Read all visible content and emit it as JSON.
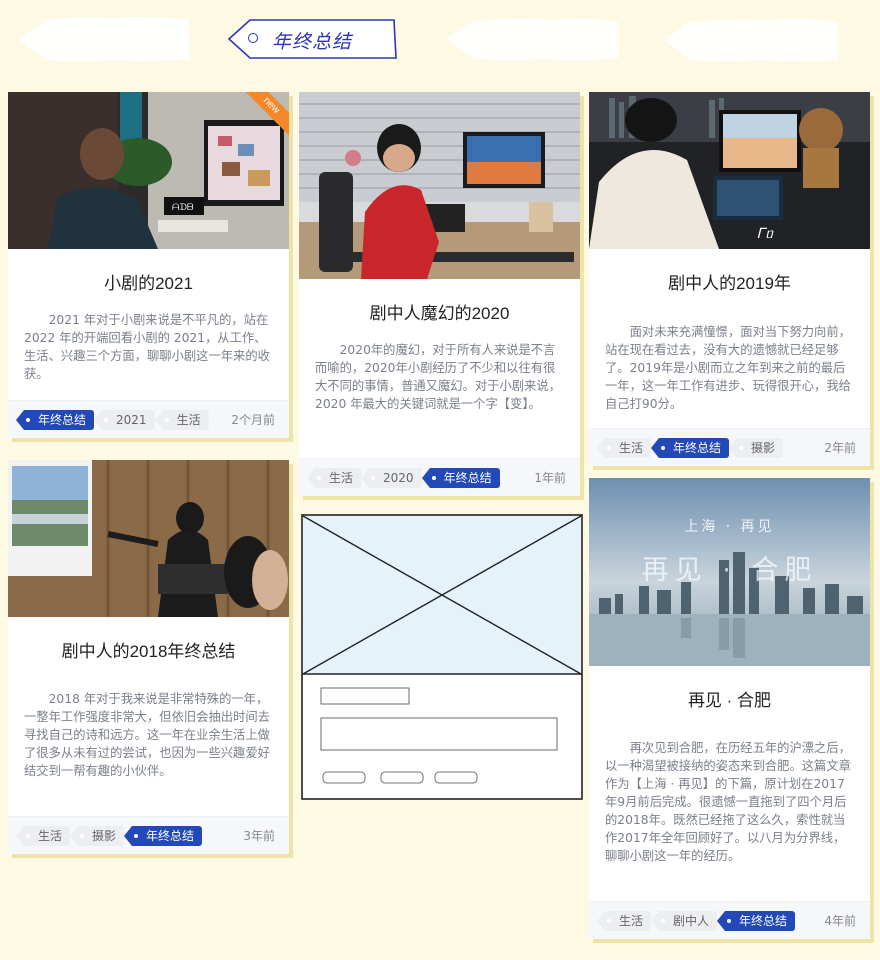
{
  "tabs": {
    "active_label": "年终总结"
  },
  "colors": {
    "accent": "#2249b7",
    "background": "#fdf9e3",
    "badge": "#f2882a"
  },
  "cards": [
    {
      "title": "小剧的2021",
      "excerpt": "2021 年对于小剧来说是不平凡的，站在 2022 年的开端回看小剧的 2021，从工作、生活、兴趣三个方面，聊聊小剧这一年来的收获。",
      "badge": "new",
      "tags": [
        "年终总结",
        "2021",
        "生活"
      ],
      "time": "2个月前"
    },
    {
      "title": "剧中人魔幻的2020",
      "excerpt": "2020年的魔幻，对于所有人来说是不言而喻的，2020年小剧经历了不少和以往有很大不同的事情，普通又魔幻。对于小剧来说，2020 年最大的关键词就是一个字【变】。",
      "tags": [
        "生活",
        "2020",
        "年终总结"
      ],
      "time": "1年前"
    },
    {
      "title": "剧中人的2019年",
      "excerpt": "面对未来充满憧憬，面对当下努力向前，站在现在看过去，没有大的遗憾就已经足够了。2019年是小剧而立之年到来之前的最后一年，这一年工作有进步、玩得很开心，我给自己打90分。",
      "tags": [
        "生活",
        "年终总结",
        "摄影"
      ],
      "time": "2年前"
    },
    {
      "title": "剧中人的2018年终总结",
      "excerpt": "2018 年对于我来说是非常特殊的一年，一整年工作强度非常大，但依旧会抽出时间去寻找自己的诗和远方。这一年在业余生活上做了很多从未有过的尝试，也因为一些兴趣爱好结交到一帮有趣的小伙伴。",
      "tags": [
        "生活",
        "摄影",
        "年终总结"
      ],
      "time": "3年前"
    },
    {
      "title": "再见 · 合肥",
      "image_caption_top": "上海 · 再见",
      "image_caption_main": "再见 · 合肥",
      "excerpt": "再次见到合肥，在历经五年的沪漂之后，以一种渴望被接纳的姿态来到合肥。这篇文章作为【上海 · 再见】的下篇，原计划在2017年9月前后完成。很遗憾一直拖到了四个月后的2018年。既然已经拖了这么久，索性就当作2017年全年回顾好了。以八月为分界线，聊聊小剧这一年的经历。",
      "tags": [
        "生活",
        "剧中人",
        "年终总结"
      ],
      "time": "4年前"
    }
  ]
}
